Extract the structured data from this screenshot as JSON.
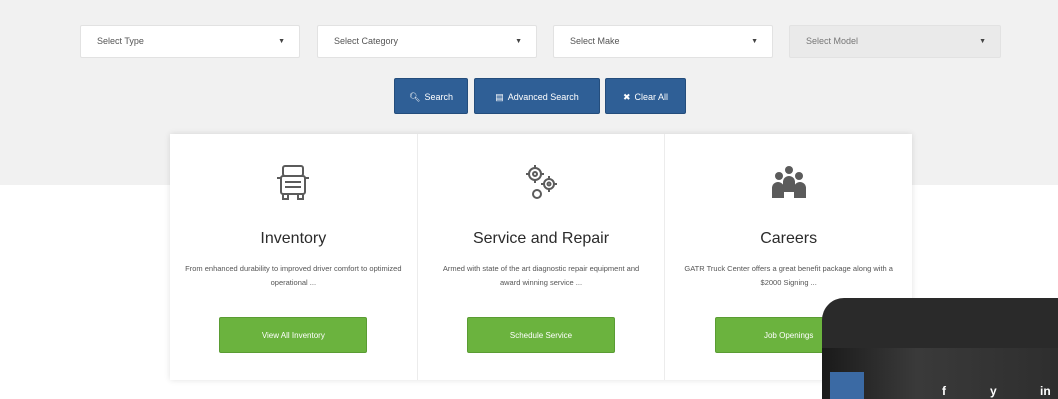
{
  "filters": {
    "type": {
      "value": "Select Type"
    },
    "category": {
      "value": "Select Category"
    },
    "make": {
      "value": "Select Make"
    },
    "model": {
      "value": "Select Model"
    }
  },
  "actions": {
    "search_label": "Search",
    "advanced_label": "Advanced Search",
    "clear_label": "Clear All"
  },
  "cards": [
    {
      "title": "Inventory",
      "description": "From enhanced durability to improved driver comfort to optimized operational ...",
      "button": "View All Inventory",
      "icon": "truck-icon"
    },
    {
      "title": "Service and Repair",
      "description": "Armed with state of the art diagnostic repair equipment and award winning service ...",
      "button": "Schedule Service",
      "icon": "gears-icon"
    },
    {
      "title": "Careers",
      "description": "GATR Truck Center offers a great benefit package along with a $2000 Signing ...",
      "button": "Job Openings",
      "icon": "people-icon"
    }
  ],
  "social": {
    "facebook": "f",
    "twitter": "y",
    "linkedin": "in"
  },
  "colors": {
    "primary_blue": "#2f5f96",
    "cta_green": "#6bb33e"
  }
}
